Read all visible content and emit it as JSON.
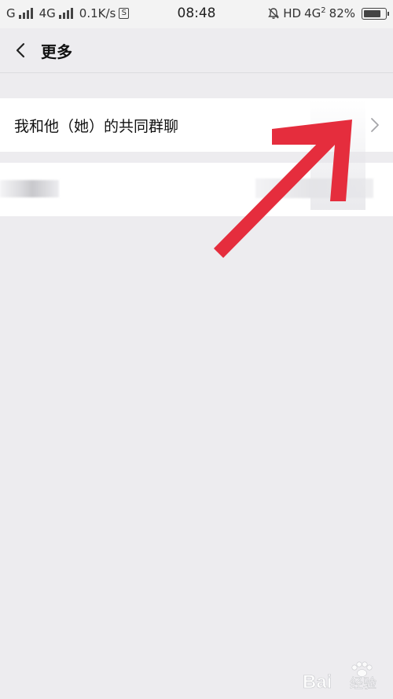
{
  "status_bar": {
    "carrier1": "G",
    "carrier2": "4G",
    "speed": "0.1K/s",
    "s_badge": "S",
    "time": "08:48",
    "hd": "HD",
    "net": "4G",
    "net_sub": "2",
    "battery": "82%",
    "battery_level": 0.82,
    "icons": [
      "signal-icon",
      "signal-icon",
      "mute-bell-icon",
      "battery-icon"
    ]
  },
  "header": {
    "title": "更多",
    "back_icon": "chevron-left-icon"
  },
  "list": {
    "common_groups_label": "我和他（她）的共同群聊",
    "chevron_icon": "chevron-right-icon"
  },
  "annotation": {
    "arrow_color": "#e52d3d"
  },
  "watermark": {
    "brand": "Bai",
    "brand_tail": "经验",
    "icon": "paw-icon"
  }
}
